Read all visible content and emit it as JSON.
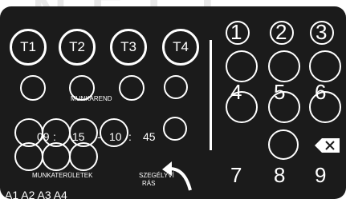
{
  "tabs": [
    "T1",
    "T2",
    "T3",
    "T4"
  ],
  "labels": {
    "munkarend": "MUNKAREND",
    "munkateruletek": "MUNKATERÜLETEK",
    "szegelyvi_line1": "SZEGÉLYVÍ",
    "szegelyvi_line2": "RÁS",
    "bottom_partial": "A1 A2 A3 A4"
  },
  "time": {
    "h1": "09",
    "m1": "15",
    "h2": "10",
    "m2": "45",
    "sep": ":",
    "dash": "-"
  },
  "keypad": {
    "one": "1",
    "two": "2",
    "three": "3",
    "four": "4",
    "five": "5",
    "six": "6",
    "seven": "7",
    "eight": "8",
    "nine": "9",
    "backspace_icon": "backspace-icon"
  },
  "icons": {
    "undo": "undo-arrow-icon"
  },
  "colors": {
    "panel": "#1b1b1b",
    "foreground": "#ffffff"
  }
}
